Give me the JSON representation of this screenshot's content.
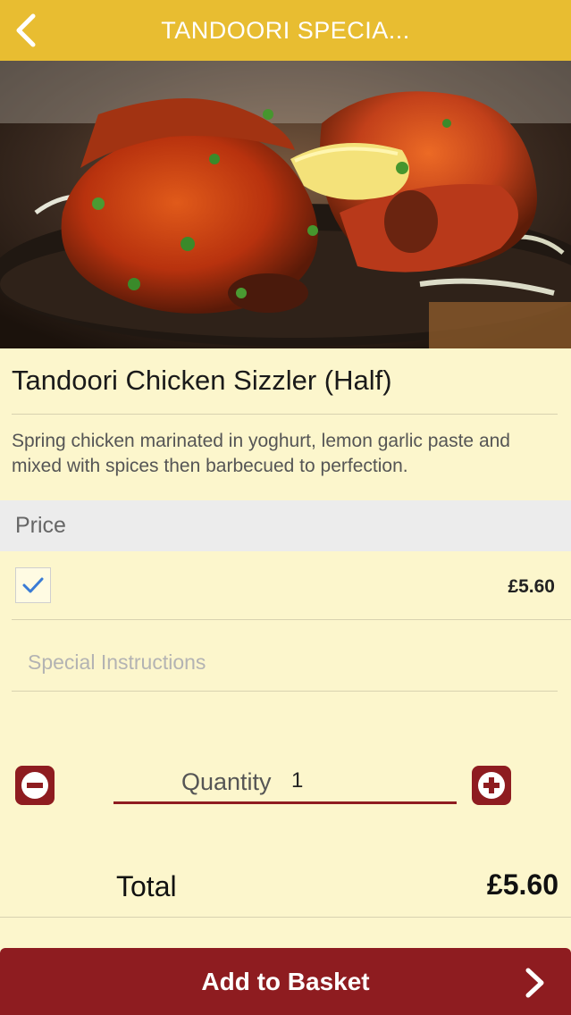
{
  "header": {
    "title": "TANDOORI SPECIA...",
    "back_icon": "chevron-left-icon"
  },
  "hero": {
    "image": "tandoori-chicken-photo"
  },
  "dish": {
    "name": "Tandoori Chicken Sizzler (Half)",
    "description": "Spring chicken marinated in yoghurt, lemon garlic paste and mixed with spices then barbecued to perfection."
  },
  "price_section": {
    "header": "Price",
    "option_checked": true,
    "option_price": "£5.60"
  },
  "special_instructions": {
    "placeholder": "Special Instructions"
  },
  "quantity": {
    "label": "Quantity",
    "value": "1"
  },
  "total": {
    "label": "Total",
    "value": "£5.60"
  },
  "basket": {
    "label": "Add to Basket"
  },
  "colors": {
    "topbar": "#e8bd31",
    "background": "#fcf6cc",
    "accent": "#8e1c20",
    "check": "#3a7bd5"
  }
}
